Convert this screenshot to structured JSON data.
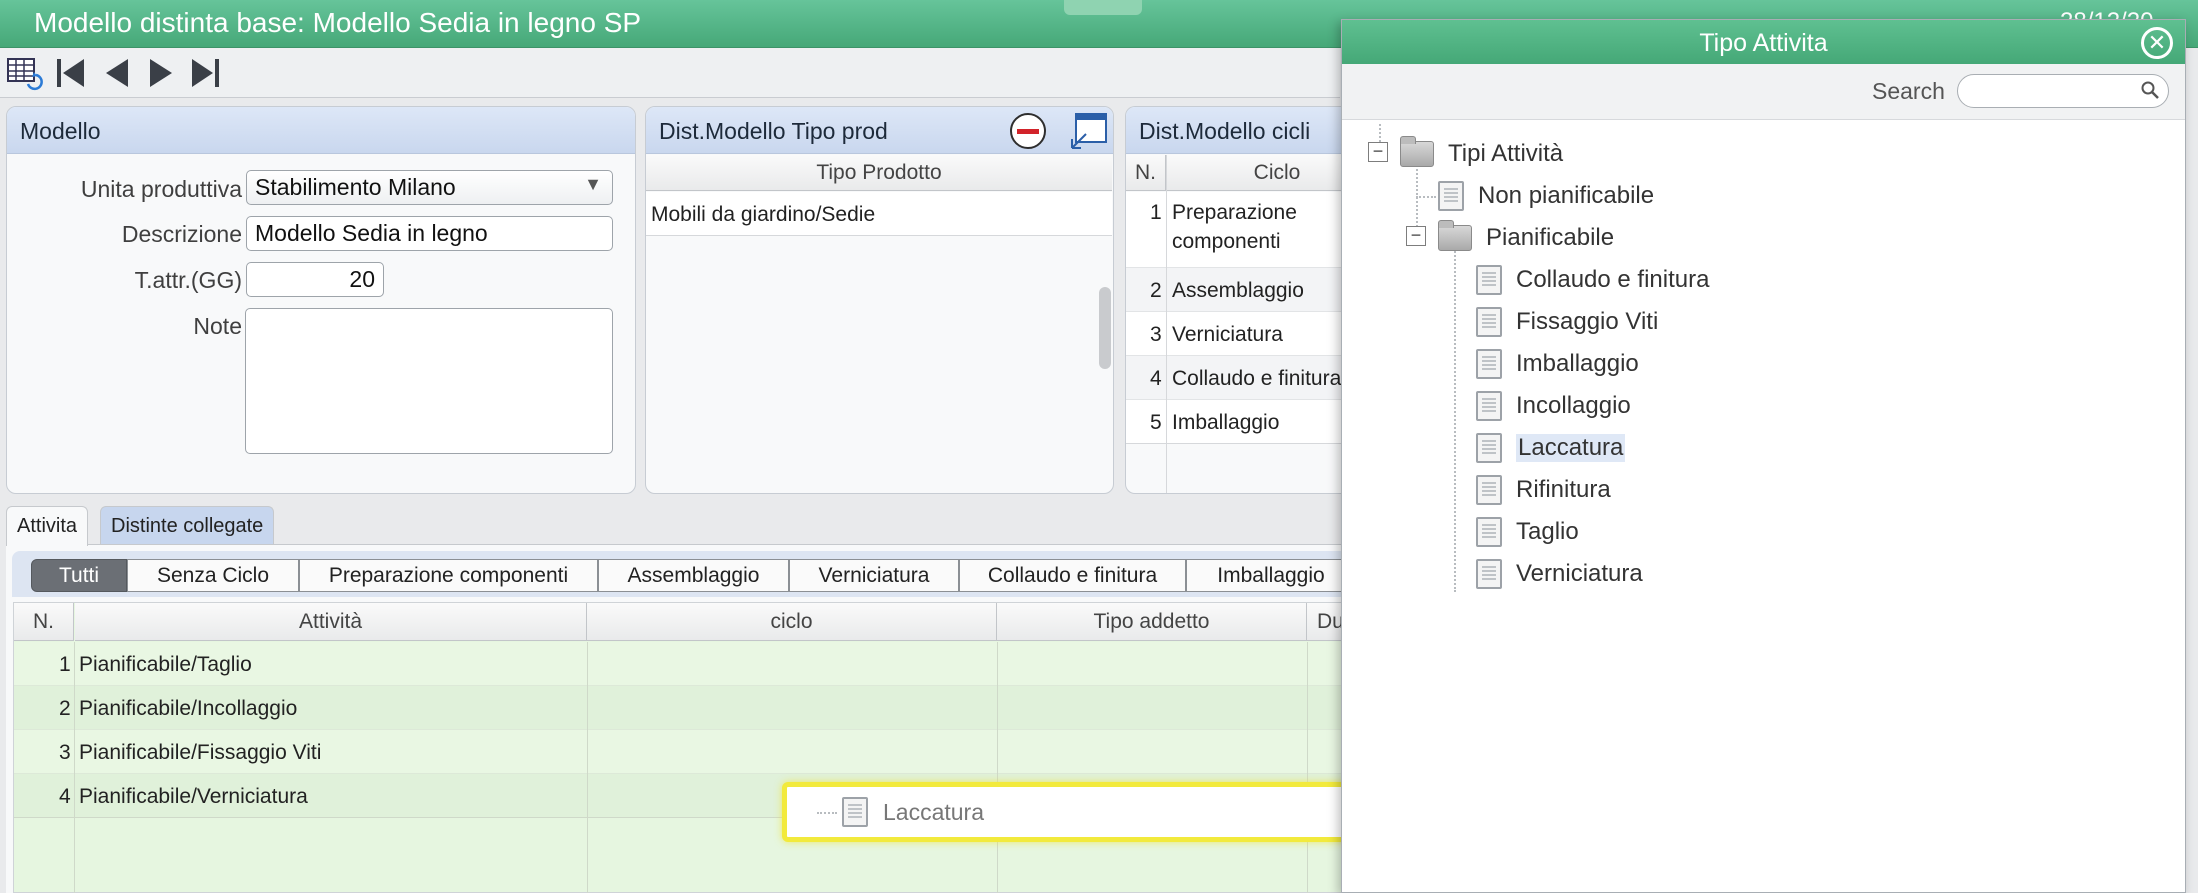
{
  "window": {
    "title": "Modello distinta base: Modello Sedia in legno SP",
    "date": "28/12/20"
  },
  "modello": {
    "header": "Modello",
    "unita_label": "Unita produttiva",
    "unita_value": "Stabilimento Milano",
    "descrizione_label": "Descrizione",
    "descrizione_value": "Modello Sedia in legno",
    "tattr_label": "T.attr.(GG)",
    "tattr_value": "20",
    "note_label": "Note",
    "note_value": ""
  },
  "tipo_prod": {
    "header": "Dist.Modello Tipo prod",
    "col": "Tipo Prodotto",
    "rows": [
      "Mobili da giardino/Sedie"
    ]
  },
  "cicli": {
    "header": "Dist.Modello cicli",
    "col_n": "N.",
    "col_ciclo": "Ciclo",
    "rows": [
      {
        "n": "1",
        "ciclo_1": "Preparazione",
        "ciclo_2": "componenti"
      },
      {
        "n": "2",
        "ciclo": "Assemblaggio"
      },
      {
        "n": "3",
        "ciclo": "Verniciatura"
      },
      {
        "n": "4",
        "ciclo": "Collaudo e finitura"
      },
      {
        "n": "5",
        "ciclo": "Imballaggio"
      }
    ]
  },
  "tabs": {
    "attivita": "Attivita",
    "distinte": "Distinte collegate"
  },
  "filters": [
    "Tutti",
    "Senza Ciclo",
    "Preparazione componenti",
    "Assemblaggio",
    "Verniciatura",
    "Collaudo e finitura",
    "Imballaggio"
  ],
  "activities": {
    "cols": {
      "n": "N.",
      "attivita": "Attività",
      "ciclo": "ciclo",
      "tipo": "Tipo addetto",
      "du": "Du"
    },
    "rows": [
      {
        "n": "1",
        "attivita": "Pianificabile/Taglio"
      },
      {
        "n": "2",
        "attivita": "Pianificabile/Incollaggio"
      },
      {
        "n": "3",
        "attivita": "Pianificabile/Fissaggio Viti"
      },
      {
        "n": "4",
        "attivita": "Pianificabile/Verniciatura"
      }
    ]
  },
  "popup": {
    "title": "Tipo Attivita",
    "search_label": "Search",
    "search_placeholder": "",
    "root": "Tipi Attività",
    "non_pian": "Non pianificabile",
    "pian": "Pianificabile",
    "children": [
      "Collaudo e finitura",
      "Fissaggio Viti",
      "Imballaggio",
      "Incollaggio",
      "Laccatura",
      "Rifinitura",
      "Taglio",
      "Verniciatura"
    ],
    "selected": "Laccatura"
  },
  "drag": {
    "label": "Laccatura"
  },
  "colors": {
    "accent": "#4fb584",
    "panel_header": "#cdd9ef",
    "row_green": "#eaf7e6",
    "drag_border": "#f2ea3c"
  }
}
